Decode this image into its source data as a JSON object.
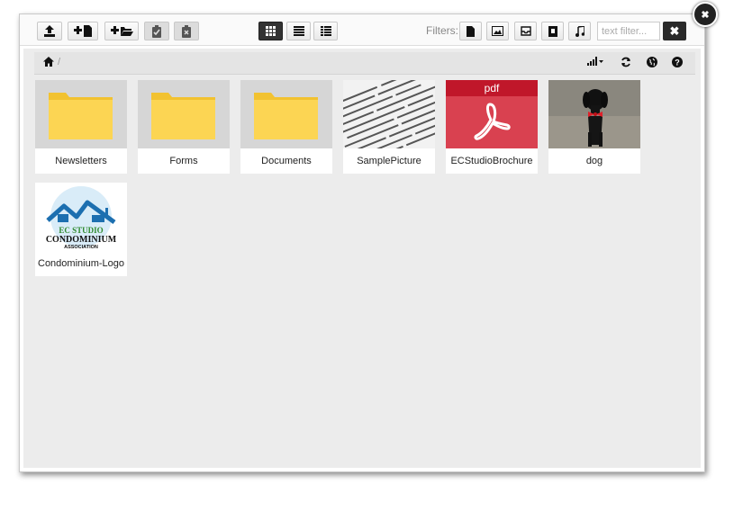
{
  "toolbar": {
    "upload_icon": "upload-icon",
    "new_file_icon": "new-file-icon",
    "new_folder_icon": "new-folder-icon",
    "paste_icon": "paste-icon",
    "clear_clipboard_icon": "clear-clipboard-icon",
    "view_grid_icon": "grid-view-icon",
    "view_list_icon": "list-view-icon",
    "view_details_icon": "details-view-icon",
    "active_view": "grid"
  },
  "filters": {
    "label": "Filters:",
    "buttons": [
      "file-icon",
      "image-icon",
      "archive-icon",
      "video-icon",
      "music-icon"
    ],
    "text_placeholder": "text filter...",
    "text_value": ""
  },
  "pathbar": {
    "home_icon": "home-icon",
    "separator": "/",
    "sort_icon": "sort-icon",
    "refresh_icon": "refresh-icon",
    "language_icon": "globe-icon",
    "help_icon": "help-icon"
  },
  "items": [
    {
      "name": "Newsletters",
      "type": "folder"
    },
    {
      "name": "Forms",
      "type": "folder"
    },
    {
      "name": "Documents",
      "type": "folder"
    },
    {
      "name": "SamplePicture",
      "type": "image"
    },
    {
      "name": "ECStudioBrochure",
      "type": "pdf",
      "badge": "pdf"
    },
    {
      "name": "dog",
      "type": "image"
    },
    {
      "name": "Condominium-Logo",
      "type": "image"
    }
  ],
  "logo_text": {
    "line1": "EC STUDIO",
    "line2": "CONDOMINIUM",
    "line3": "ASSOCIATION"
  },
  "colors": {
    "folder": "#f9d04f",
    "pdf_red": "#d94150",
    "active_view": "#333333"
  }
}
